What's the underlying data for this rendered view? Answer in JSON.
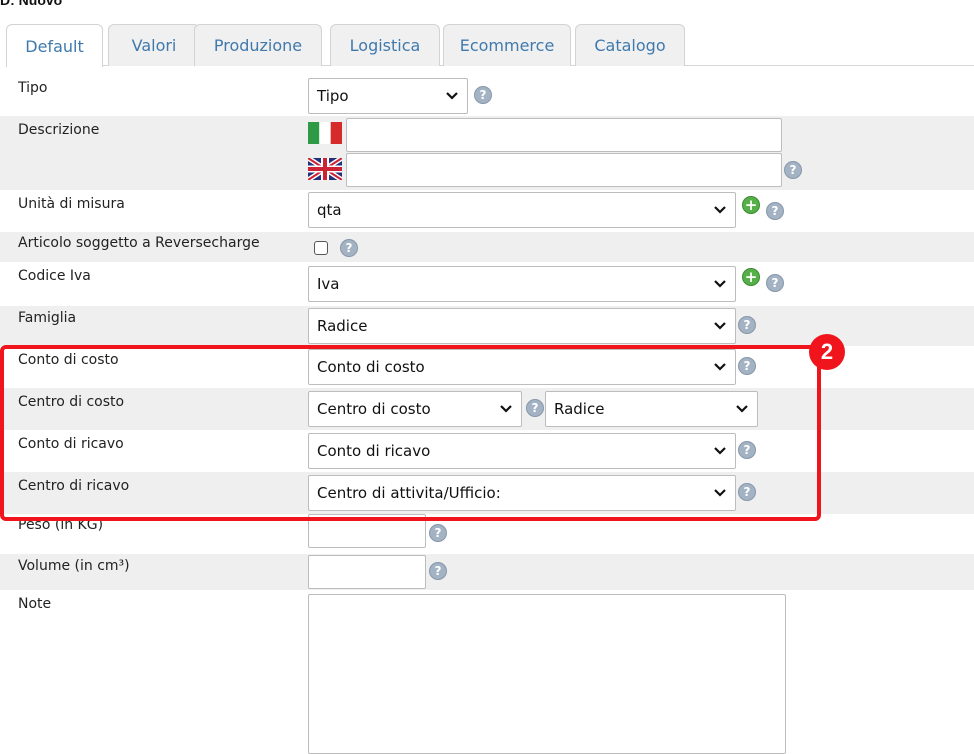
{
  "page": {
    "title": "D: Nuovo"
  },
  "tabs": [
    "Default",
    "Valori",
    "Produzione",
    "Logistica",
    "Ecommerce",
    "Catalogo"
  ],
  "active_tab": "Default",
  "form": {
    "tipo": {
      "label": "Tipo",
      "value": "Tipo"
    },
    "descrizione": {
      "label": "Descrizione",
      "it_value": "",
      "en_value": ""
    },
    "unita": {
      "label": "Unità di misura",
      "value": "qta"
    },
    "reverse": {
      "label": "Articolo soggetto a Reversecharge",
      "checked": false
    },
    "iva": {
      "label": "Codice Iva",
      "value": "Iva"
    },
    "famiglia": {
      "label": "Famiglia",
      "value": "Radice"
    },
    "conto_costo": {
      "label": "Conto di costo",
      "value": "Conto di costo"
    },
    "centro_costo": {
      "label": "Centro di costo",
      "value": "Centro di costo",
      "value2": "Radice"
    },
    "conto_ricavo": {
      "label": "Conto di ricavo",
      "value": "Conto di ricavo"
    },
    "centro_ricavo": {
      "label": "Centro di ricavo",
      "value": "Centro di attivita/Ufficio:"
    },
    "peso": {
      "label": "Peso (in KG)",
      "value": ""
    },
    "volume": {
      "label": "Volume (in cm³)",
      "value": ""
    },
    "note": {
      "label": "Note",
      "value": ""
    }
  },
  "annotation": {
    "badge": "2",
    "color": "#f0151c"
  },
  "icons": {
    "help": "?",
    "add": "+"
  },
  "colors": {
    "tab_text": "#3f79ad",
    "row_alt": "#efefef",
    "add_green": "#56b04a"
  }
}
